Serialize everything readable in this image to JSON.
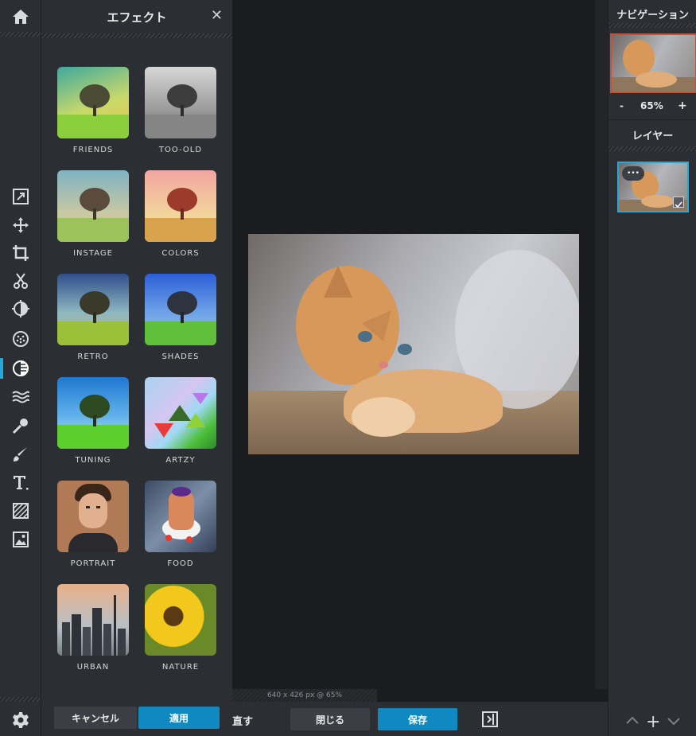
{
  "effects_panel": {
    "title": "エフェクト",
    "close_glyph": "✕",
    "effects": [
      {
        "label": "FRIENDS"
      },
      {
        "label": "TOO-OLD"
      },
      {
        "label": "INSTAGE"
      },
      {
        "label": "COLORS"
      },
      {
        "label": "RETRO"
      },
      {
        "label": "SHADES"
      },
      {
        "label": "TUNING"
      },
      {
        "label": "ARTZY"
      },
      {
        "label": "PORTRAIT"
      },
      {
        "label": "FOOD"
      },
      {
        "label": "URBAN"
      },
      {
        "label": "NATURE"
      }
    ],
    "cancel_label": "キャンセル",
    "apply_label": "適用"
  },
  "toolbar": {
    "tools": [
      "home-icon",
      "arrange-icon",
      "move-icon",
      "crop-icon",
      "cut-icon",
      "adjust-icon",
      "filter-icon",
      "effects-icon",
      "liquify-icon",
      "heal-icon",
      "draw-icon",
      "text-icon",
      "cutout-icon",
      "add-image-icon",
      "settings-icon"
    ],
    "active_tool": "effects-icon"
  },
  "canvas": {
    "status_text": "640 x 426 px @ 65%"
  },
  "bottom_bar": {
    "redo_partial": "直す",
    "close_label": "閉じる",
    "save_label": "保存"
  },
  "right_panel": {
    "navigation_title": "ナビゲーション",
    "zoom_minus": "-",
    "zoom_value": "65%",
    "zoom_plus": "+",
    "layers_title": "レイヤー",
    "layer_menu_glyph": "•••",
    "bottom_add": "+"
  },
  "colors": {
    "accent_blue": "#1089c0",
    "panel_bg": "#2b2e33",
    "canvas_bg": "#1b1c1f",
    "nav_border": "#c8503a"
  }
}
